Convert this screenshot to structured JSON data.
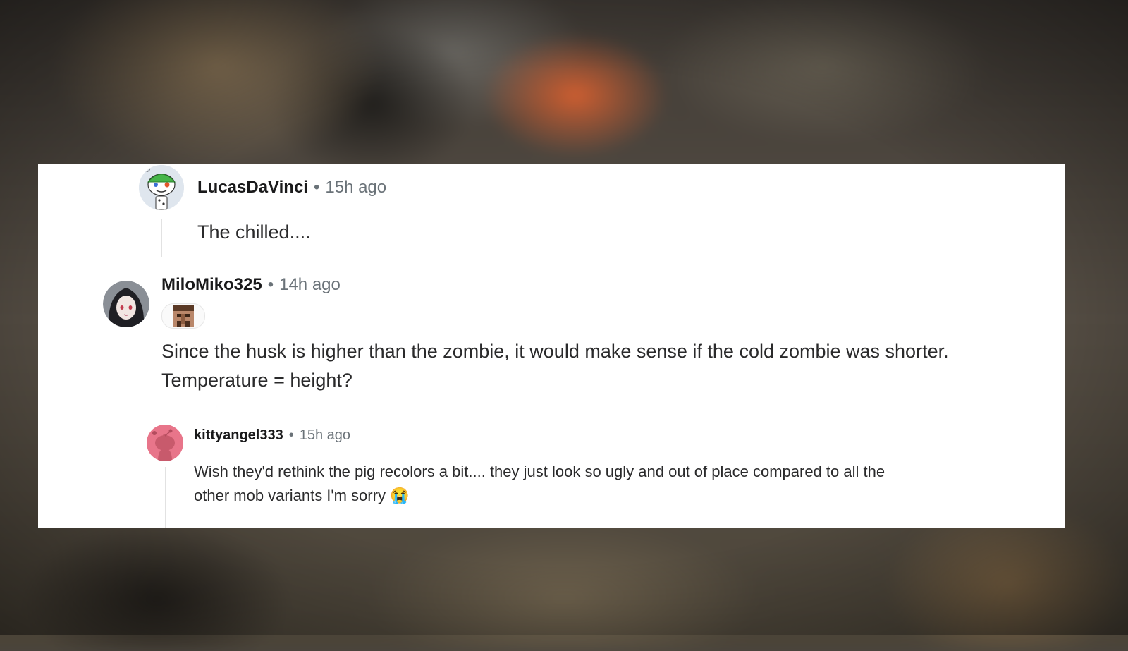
{
  "comments": [
    {
      "username": "LucasDaVinci",
      "separator": "•",
      "time": "15h ago",
      "body": "The chilled....",
      "avatar_icon": "snoo-avatar-green-helmet-icon"
    },
    {
      "username": "MiloMiko325",
      "separator": "•",
      "time": "14h ago",
      "flair_icon": "minecraft-villager-flair-icon",
      "body_lines": [
        "Since the husk is higher than the zombie, it would make sense if the cold zombie was shorter.",
        "Temperature = height?"
      ],
      "avatar_icon": "anime-girl-avatar-icon"
    },
    {
      "username": "kittyangel333",
      "separator": "•",
      "time": "15h ago",
      "body_lines": [
        "Wish they'd rethink the pig recolors a bit.... they just look so ugly and out of place compared to all the",
        "other mob variants I'm sorry"
      ],
      "emoji": "😭",
      "avatar_icon": "snoo-avatar-pink-icon"
    }
  ],
  "colors": {
    "panel_bg": "#ffffff",
    "username": "#1a1a1b",
    "meta": "#6a7278",
    "body_text": "#2a2a2b",
    "pink_avatar": "#e8758a"
  }
}
